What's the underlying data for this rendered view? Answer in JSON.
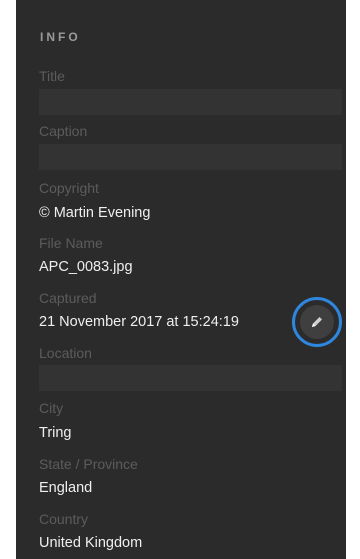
{
  "panel": {
    "title": "INFO"
  },
  "fields": {
    "title": {
      "label": "Title",
      "value": ""
    },
    "caption": {
      "label": "Caption",
      "value": ""
    },
    "copyright": {
      "label": "Copyright",
      "value": "© Martin Evening"
    },
    "file_name": {
      "label": "File Name",
      "value": "APC_0083.jpg"
    },
    "captured": {
      "label": "Captured",
      "value": "21 November 2017 at 15:24:19"
    },
    "location": {
      "label": "Location",
      "value": ""
    },
    "city": {
      "label": "City",
      "value": "Tring"
    },
    "state": {
      "label": "State / Province",
      "value": "England"
    },
    "country": {
      "label": "Country",
      "value": "United Kingdom"
    }
  },
  "icons": {
    "edit": "pencil-icon"
  },
  "colors": {
    "panel_bg": "#2b2b2b",
    "input_bg": "#333333",
    "label": "#5c5c5c",
    "value": "#efefef",
    "accent_ring": "#2e86de"
  }
}
